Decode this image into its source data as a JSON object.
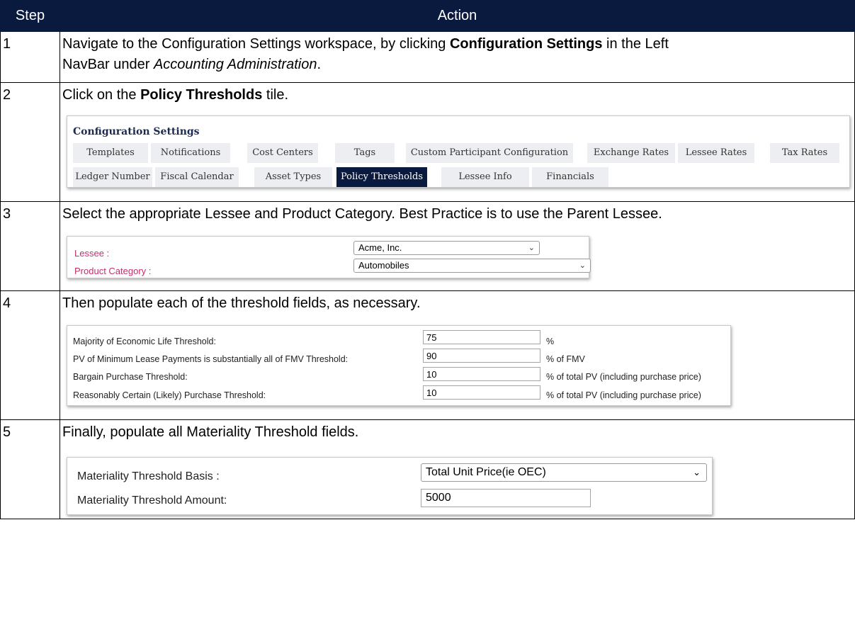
{
  "header": {
    "step": "Step",
    "action": "Action"
  },
  "rows": [
    {
      "num": "1",
      "line1_pre": "Navigate to the Configuration Settings workspace, by clicking ",
      "line1_bold": "Configuration Settings",
      "line1_post": " in the Left",
      "line2_pre": "NavBar under ",
      "line2_italic": "Accounting Administration",
      "line2_post": "."
    },
    {
      "num": "2",
      "pre": "Click on the ",
      "bold": "Policy Thresholds",
      "post": " tile."
    },
    {
      "num": "3",
      "text": "Select the appropriate Lessee and Product Category. Best Practice is to use the Parent Lessee."
    },
    {
      "num": "4",
      "text": "Then populate each of the threshold fields, as necessary."
    },
    {
      "num": "5",
      "text": "Finally, populate all Materiality Threshold fields."
    }
  ],
  "config": {
    "title": "Configuration Settings",
    "tiles": [
      "Templates",
      "Notifications",
      "Cost Centers",
      "Tags",
      "Custom Participant Configuration",
      "Exchange Rates",
      "Lessee Rates",
      "Tax Rates",
      "Ledger Number",
      "Fiscal Calendar",
      "Asset Types",
      "Policy Thresholds",
      "Lessee Info",
      "Financials"
    ],
    "active_tile": "Policy Thresholds"
  },
  "lessee_form": {
    "lessee_label": "Lessee :",
    "lessee_value": "Acme, Inc.",
    "category_label": "Product Category :",
    "category_value": "Automobiles"
  },
  "thresholds": [
    {
      "label": "Majority of Economic Life Threshold:",
      "value": "75",
      "suffix": "%"
    },
    {
      "label": "PV of Minimum Lease Payments is substantially all of FMV Threshold:",
      "value": "90",
      "suffix": "% of FMV"
    },
    {
      "label": "Bargain Purchase Threshold:",
      "value": "10",
      "suffix": "% of total PV (including purchase price)"
    },
    {
      "label": "Reasonably Certain (Likely) Purchase Threshold:",
      "value": "10",
      "suffix": "% of total PV (including purchase price)"
    }
  ],
  "materiality": {
    "basis_label": "Materiality Threshold Basis :",
    "basis_value": "Total Unit Price(ie OEC)",
    "amount_label": "Materiality Threshold Amount:",
    "amount_value": "5000"
  },
  "colors": {
    "header_bg": "#0a1a3f",
    "active_tile": "#0a1a3f",
    "label_pink": "#c0306b"
  }
}
